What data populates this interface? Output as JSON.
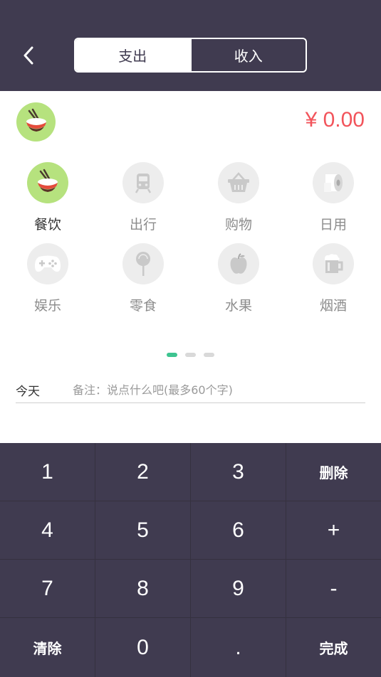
{
  "header": {
    "tabs": [
      {
        "label": "支出",
        "active": true
      },
      {
        "label": "收入",
        "active": false
      }
    ]
  },
  "entry": {
    "amount": "¥ 0.00",
    "selected_icon": "rice-bowl-icon"
  },
  "categories": [
    {
      "label": "餐饮",
      "icon": "rice-bowl-icon",
      "active": true
    },
    {
      "label": "出行",
      "icon": "train-icon",
      "active": false
    },
    {
      "label": "购物",
      "icon": "shopping-basket-icon",
      "active": false
    },
    {
      "label": "日用",
      "icon": "tissue-roll-icon",
      "active": false
    },
    {
      "label": "娱乐",
      "icon": "gamepad-icon",
      "active": false
    },
    {
      "label": "零食",
      "icon": "lollipop-icon",
      "active": false
    },
    {
      "label": "水果",
      "icon": "apple-icon",
      "active": false
    },
    {
      "label": "烟酒",
      "icon": "beer-mug-icon",
      "active": false
    }
  ],
  "pager": {
    "pages": 3,
    "current": 0
  },
  "note": {
    "date": "今天",
    "placeholder": "备注：说点什么吧(最多60个字)"
  },
  "keypad": {
    "keys": [
      "1",
      "2",
      "3",
      "删除",
      "4",
      "5",
      "6",
      "+",
      "7",
      "8",
      "9",
      "-",
      "清除",
      "0",
      ".",
      "完成"
    ]
  },
  "colors": {
    "header_bg": "#403b50",
    "accent_green": "#b6e27e",
    "amount_red": "#f2545b",
    "pager_active": "#3dc490"
  }
}
